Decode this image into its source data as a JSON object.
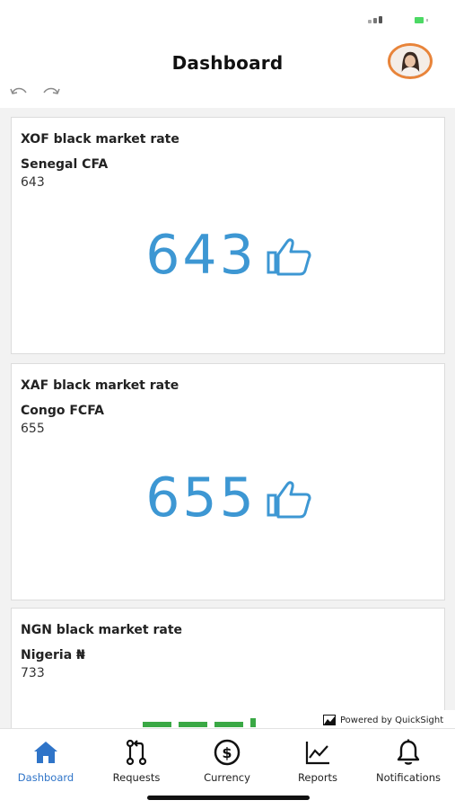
{
  "header": {
    "title": "Dashboard"
  },
  "cards": [
    {
      "title": "XOF black market rate",
      "subtitle": "Senegal CFA",
      "value": "643",
      "kpi": "643",
      "kpi_icon": "thumbs-up-icon"
    },
    {
      "title": "XAF black market rate",
      "subtitle": "Congo FCFA",
      "value": "655",
      "kpi": "655",
      "kpi_icon": "thumbs-up-icon"
    },
    {
      "title": "NGN black market rate",
      "subtitle": "Nigeria ₦",
      "value": "733"
    }
  ],
  "powered_by": "Powered by QuickSight",
  "tabs": [
    {
      "label": "Dashboard",
      "icon": "home-icon",
      "active": true
    },
    {
      "label": "Requests",
      "icon": "pull-request-icon",
      "active": false
    },
    {
      "label": "Currency",
      "icon": "dollar-circle-icon",
      "active": false
    },
    {
      "label": "Reports",
      "icon": "line-chart-icon",
      "active": false
    },
    {
      "label": "Notifications",
      "icon": "bell-icon",
      "active": false
    }
  ],
  "colors": {
    "kpi_blue": "#3d97d3",
    "kpi_green": "#3aa845",
    "tab_active": "#2f74c8",
    "avatar_ring": "#e8843a"
  }
}
